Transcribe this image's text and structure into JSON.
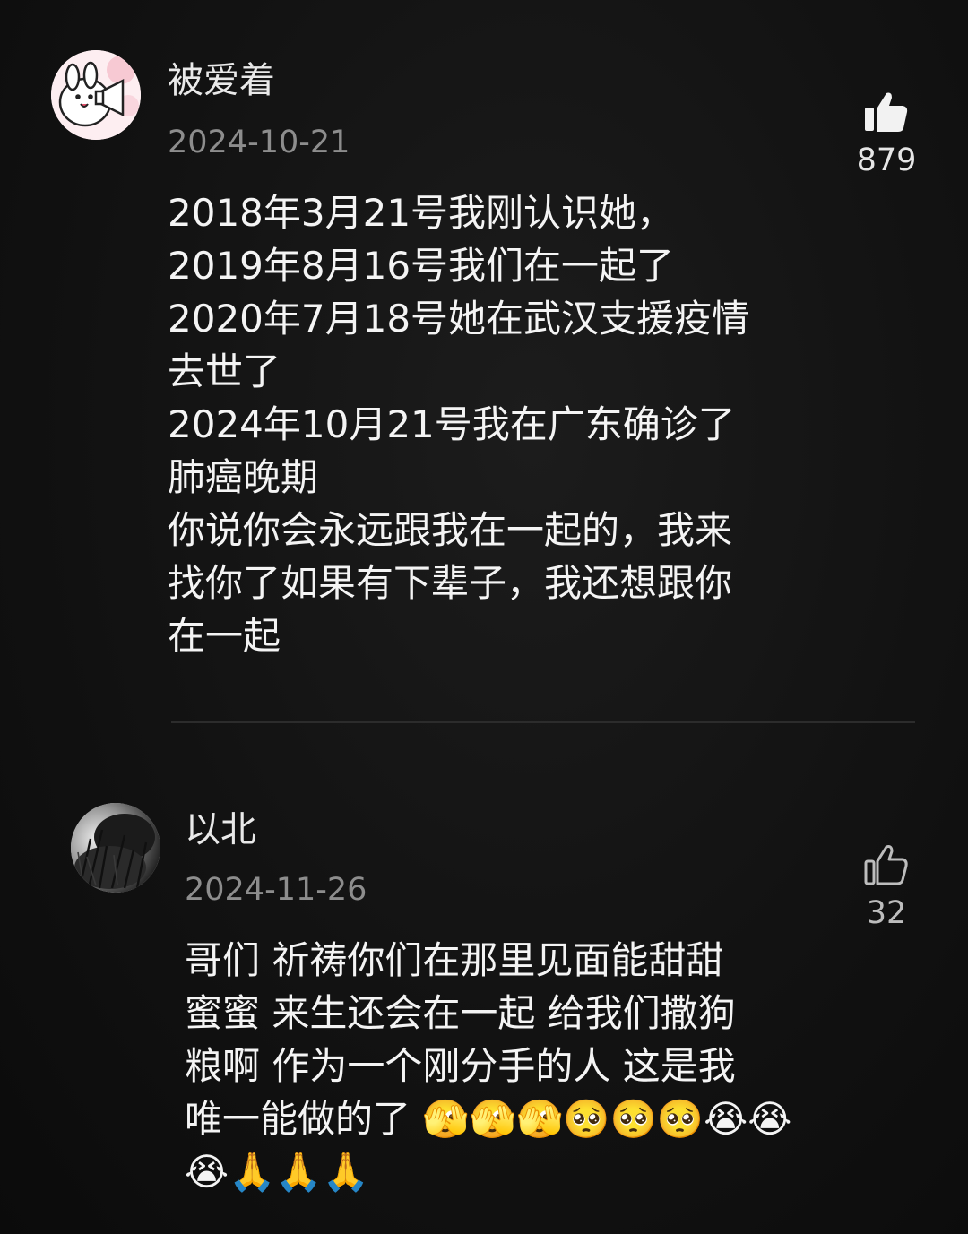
{
  "comments": [
    {
      "username": "被爱着",
      "date": "2024-10-21",
      "lines": [
        "2018年3月21号我刚认识她，",
        "2019年8月16号我们在一起了",
        "2020年7月18号她在武汉支援疫情",
        "去世了",
        "2024年10月21号我在广东确诊了",
        "肺癌晚期",
        "你说你会永远跟我在一起的，我来",
        "找你了如果有下辈子，我还想跟你",
        "在一起"
      ],
      "likes": "879",
      "liked": true,
      "avatar_icon": "cartoon-bunny-megaphone-avatar"
    },
    {
      "username": "以北",
      "date": "2024-11-26",
      "lines": [
        "哥们 祈祷你们在那里见面能甜甜",
        "蜜蜜  来生还会在一起  给我们撒狗",
        "粮啊  作为一个刚分手的人  这是我",
        "唯一能做的了   🫣🫣🫣🥺🥺🥺😭😭",
        "😭🙏🙏🙏"
      ],
      "likes": "32",
      "liked": false,
      "avatar_icon": "dark-grass-photo-avatar"
    }
  ],
  "colors": {
    "background": "#121212",
    "text": "#f4f4f4",
    "secondary_text": "#8d8d8d",
    "divider": "#2c2c2c"
  }
}
